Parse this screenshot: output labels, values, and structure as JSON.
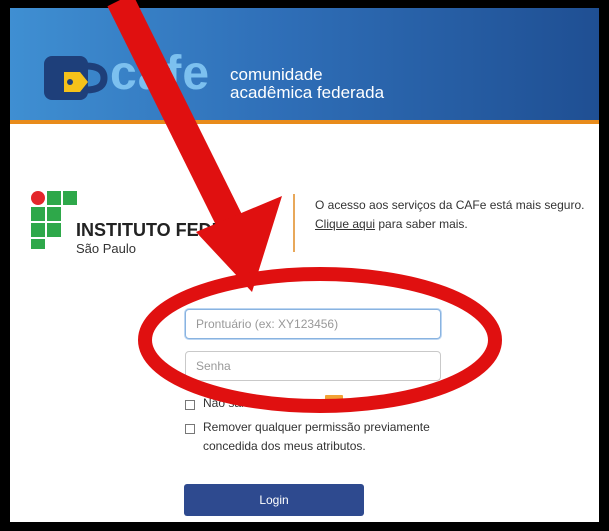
{
  "banner": {
    "logo_text": "cafe",
    "tagline_line1": "comunidade",
    "tagline_line2": "acadêmica federada",
    "colors": {
      "gradient_start": "#3f8fd2",
      "gradient_end": "#1f4f93",
      "accent_line": "#e88b1b"
    }
  },
  "institution": {
    "name": "INSTITUTO FEDERAL",
    "subname": "São Paulo"
  },
  "notice": {
    "text": "O acesso aos serviços da CAFe está mais seguro.",
    "link_text": "Clique aqui",
    "link_suffix": " para saber mais."
  },
  "form": {
    "username_placeholder": "Prontuário (ex: XY123456)",
    "password_placeholder": "Senha",
    "remember_label": "Não salvar",
    "revoke_label_line1": "Remover qualquer permissão previamente",
    "revoke_label_line2": "concedida dos meus atributos.",
    "login_label": "Login",
    "button_color": "#2e4a8f"
  },
  "annotation": {
    "color": "#e01010",
    "icons": [
      "arrow",
      "ellipse"
    ]
  }
}
